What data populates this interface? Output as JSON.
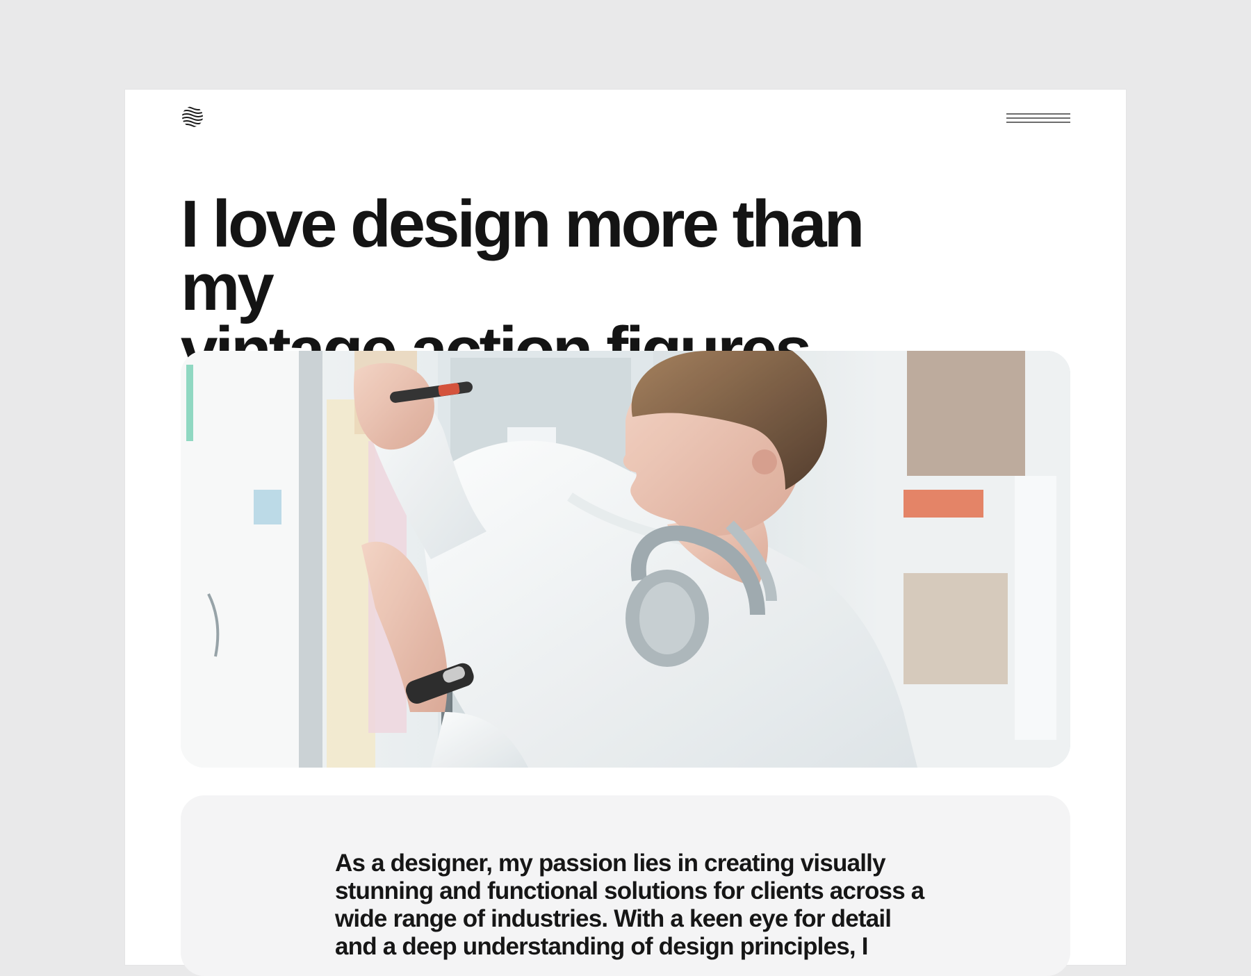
{
  "header": {
    "logo_icon": "wave-sphere-logo-icon",
    "menu_icon": "hamburger-menu-icon"
  },
  "hero": {
    "title_line1": "I love design more than my",
    "title_line2": "vintage action figures.",
    "image_icon": "designer-photo"
  },
  "about": {
    "text": "As a designer, my passion lies in creating visually stunning and functional solutions for clients across a wide range of industries. With a keen eye for detail and a deep understanding of design principles, I"
  },
  "colors": {
    "background": "#e9e9ea",
    "card": "#ffffff",
    "text": "#141414",
    "about_card": "#f4f4f5"
  }
}
